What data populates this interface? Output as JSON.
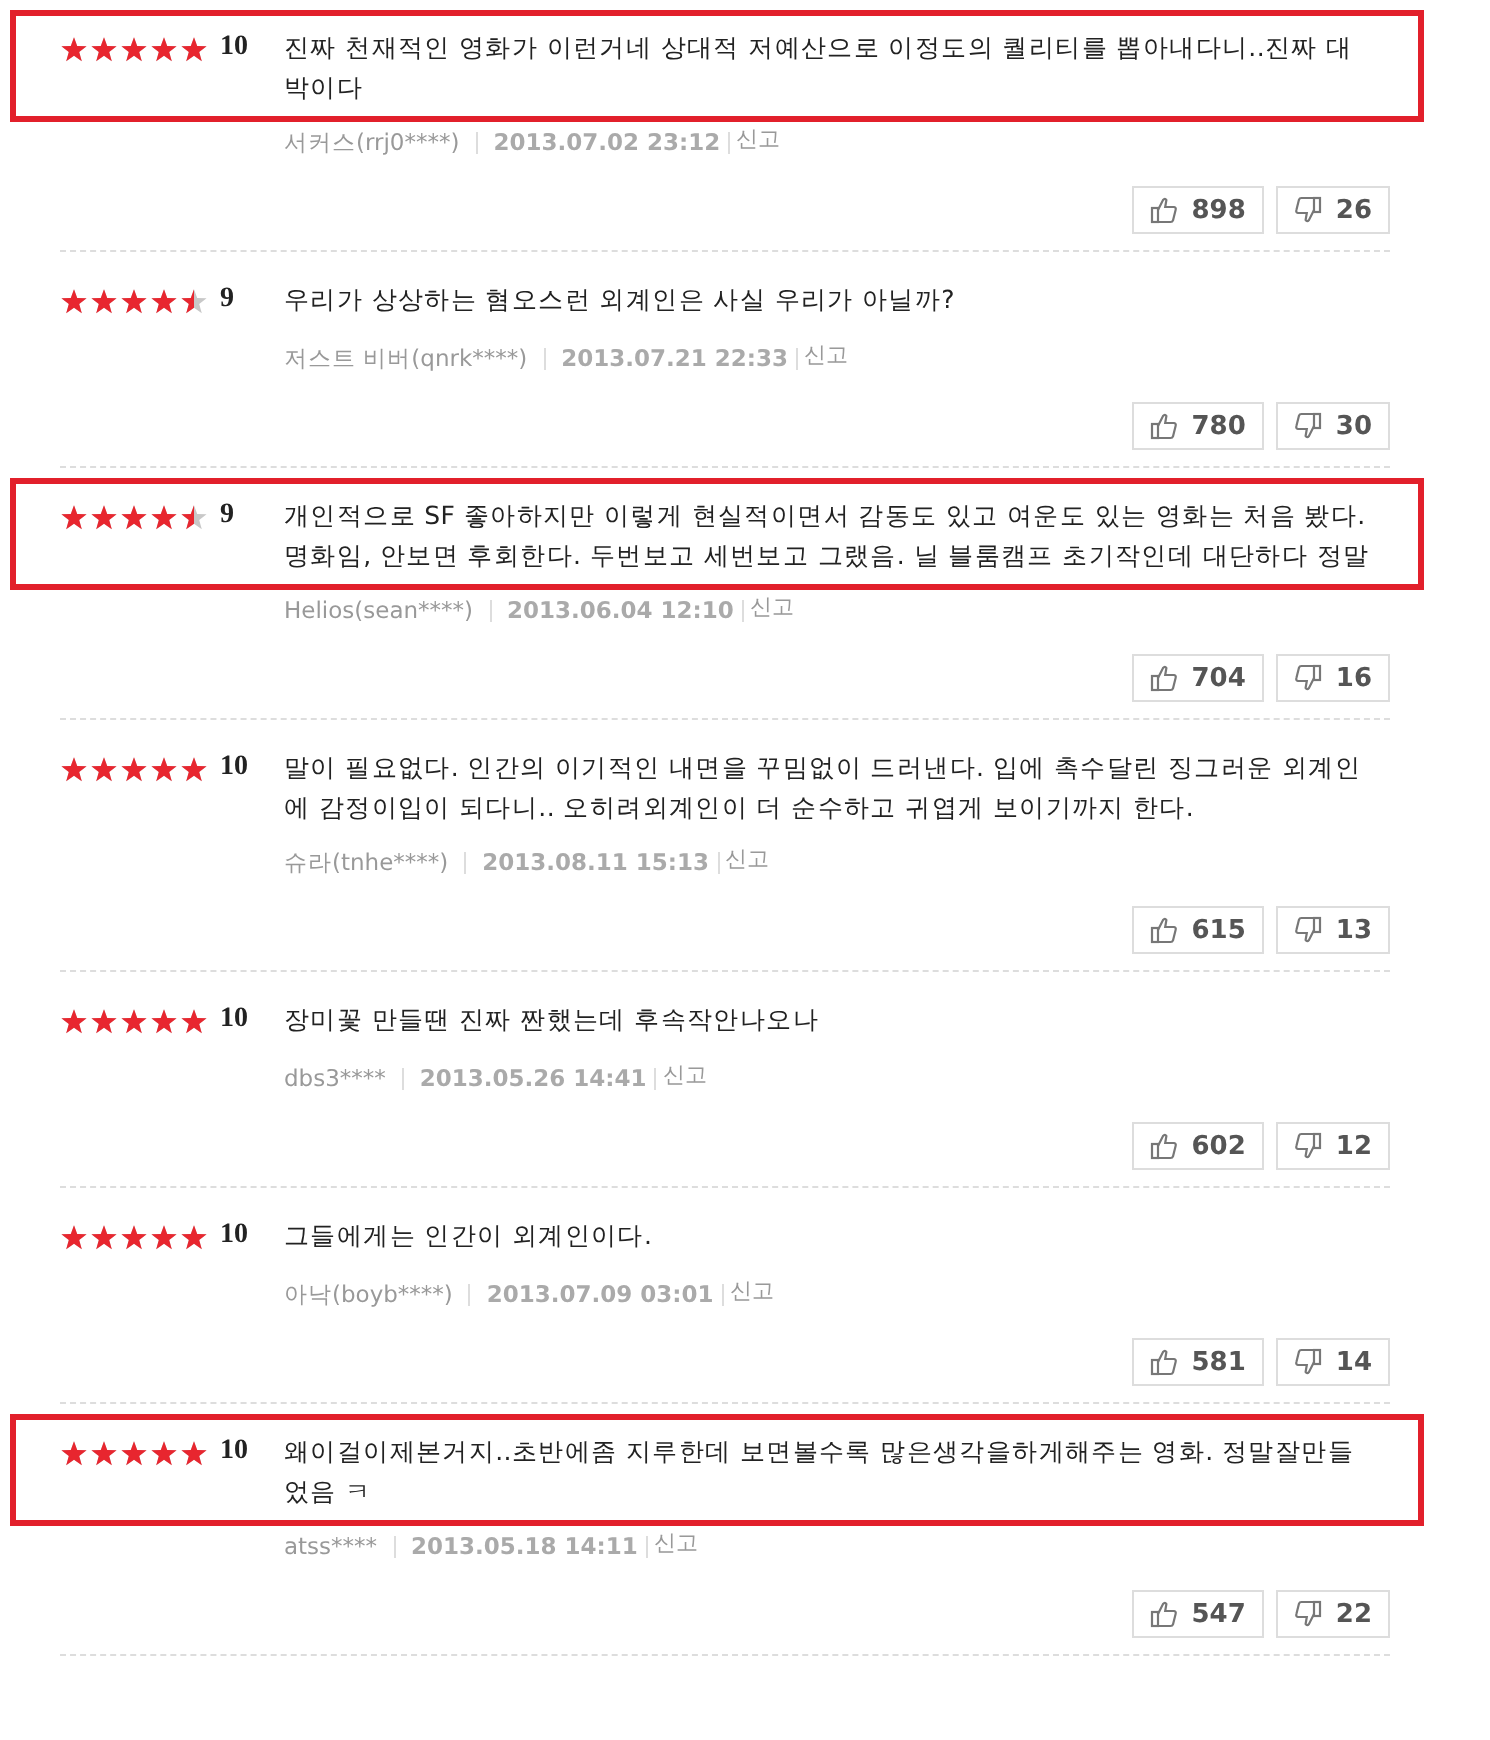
{
  "reviews": [
    {
      "stars": 5,
      "score": "10",
      "highlighted": true,
      "text": "진짜 천재적인 영화가 이런거네 상대적 저예산으로 이정도의 퀄리티를 뽑아내다니..진짜 대박이다",
      "author": "서커스(rrj0****)",
      "date": "2013.07.02 23:12",
      "report": "신고",
      "likes": "898",
      "dislikes": "26"
    },
    {
      "stars": 4.5,
      "score": "9",
      "highlighted": false,
      "text": "우리가 상상하는 혐오스런 외계인은 사실 우리가 아닐까?",
      "author": "저스트 비버(qnrk****)",
      "date": "2013.07.21 22:33",
      "report": "신고",
      "likes": "780",
      "dislikes": "30"
    },
    {
      "stars": 4.5,
      "score": "9",
      "highlighted": true,
      "text": "개인적으로 SF 좋아하지만 이렇게 현실적이면서 감동도 있고 여운도 있는 영화는 처음 봤다. 명화임, 안보면 후회한다. 두번보고 세번보고 그랬음. 닐 블룸캠프 초기작인데 대단하다 정말",
      "author": "Helios(sean****)",
      "date": "2013.06.04 12:10",
      "report": "신고",
      "likes": "704",
      "dislikes": "16"
    },
    {
      "stars": 5,
      "score": "10",
      "highlighted": false,
      "text": "말이 필요없다. 인간의 이기적인 내면을 꾸밈없이 드러낸다. 입에 촉수달린 징그러운 외계인에 감정이입이 되다니.. 오히려외계인이 더 순수하고 귀엽게 보이기까지 한다.",
      "author": "슈라(tnhe****)",
      "date": "2013.08.11 15:13",
      "report": "신고",
      "likes": "615",
      "dislikes": "13"
    },
    {
      "stars": 5,
      "score": "10",
      "highlighted": false,
      "text": "장미꽃 만들땐 진짜 짠했는데 후속작안나오나",
      "author": "dbs3****",
      "date": "2013.05.26 14:41",
      "report": "신고",
      "likes": "602",
      "dislikes": "12"
    },
    {
      "stars": 5,
      "score": "10",
      "highlighted": false,
      "text": "그들에게는 인간이 외계인이다.",
      "author": "아낙(boyb****)",
      "date": "2013.07.09 03:01",
      "report": "신고",
      "likes": "581",
      "dislikes": "14"
    },
    {
      "stars": 5,
      "score": "10",
      "highlighted": true,
      "text": "왜이걸이제본거지..초반에좀 지루한데 보면볼수록 많은생각을하게해주는 영화. 정말잘만들었음 ㅋ",
      "author": "atss****",
      "date": "2013.05.18 14:11",
      "report": "신고",
      "likes": "547",
      "dislikes": "22"
    }
  ]
}
